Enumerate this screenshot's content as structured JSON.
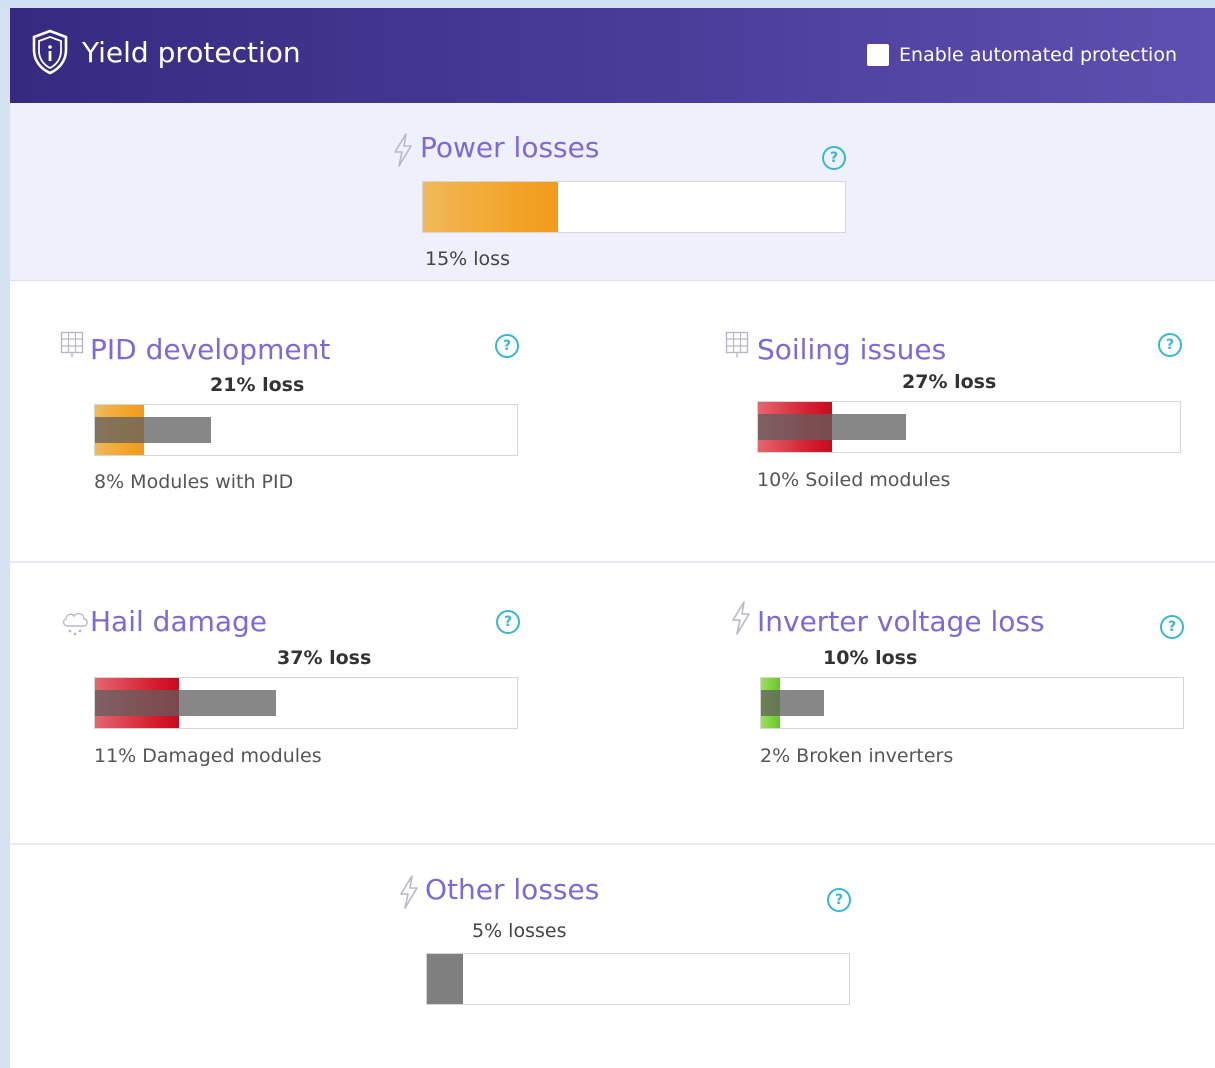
{
  "header": {
    "title": "Yield protection",
    "enable_label": "Enable automated protection",
    "enable_checked": false,
    "background": "#3f338f"
  },
  "power": {
    "title": "Power losses",
    "loss_text": "15% loss",
    "loss_fraction": 0.32,
    "color": "#f2a326",
    "icon": "lightning-icon"
  },
  "pid": {
    "title": "PID development",
    "loss_text": "21% loss",
    "caption": "8% Modules with PID",
    "loss_fraction": 0.115,
    "module_fraction": 0.275,
    "color": "#f2a326",
    "icon": "solar-panel-icon"
  },
  "soiling": {
    "title": "Soiling issues",
    "loss_text": "27% loss",
    "caption": "10% Soiled modules",
    "loss_fraction": 0.175,
    "module_fraction": 0.35,
    "color": "#d41e2d",
    "icon": "solar-panel-icon"
  },
  "hail": {
    "title": "Hail damage",
    "loss_text": "37% loss",
    "caption": "11% Damaged modules",
    "loss_fraction": 0.2,
    "module_fraction": 0.43,
    "color": "#d41e2d",
    "icon": "hail-cloud-icon"
  },
  "inverter": {
    "title": "Inverter voltage loss",
    "loss_text": "10% loss",
    "caption": "2% Broken inverters",
    "loss_fraction": 0.045,
    "module_fraction": 0.15,
    "color": "#66c728",
    "icon": "lightning-icon"
  },
  "other": {
    "title": "Other losses",
    "loss_text": "5% losses",
    "loss_fraction": 0.085,
    "color": "#7f7f7f",
    "icon": "lightning-icon"
  }
}
